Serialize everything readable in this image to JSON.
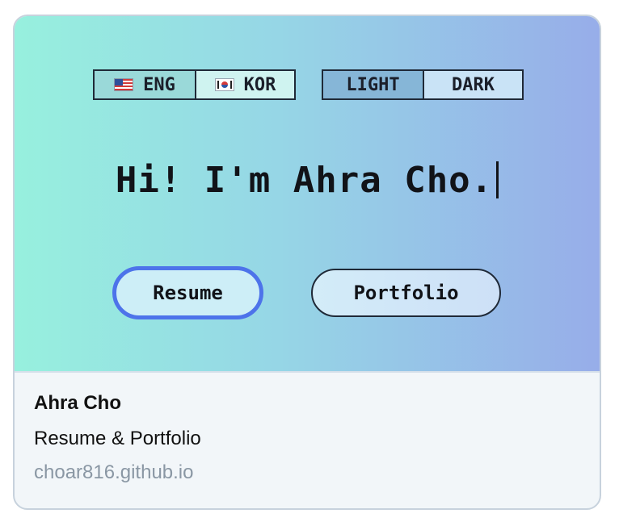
{
  "hero": {
    "language_toggle": {
      "options": [
        {
          "label": "ENG",
          "icon": "us-flag-icon"
        },
        {
          "label": "KOR",
          "icon": "korea-flag-icon"
        }
      ],
      "selected": "ENG"
    },
    "theme_toggle": {
      "options": [
        {
          "label": "LIGHT"
        },
        {
          "label": "DARK"
        }
      ],
      "selected": "LIGHT"
    },
    "headline": "Hi! I'm Ahra Cho.",
    "buttons": {
      "resume": "Resume",
      "portfolio": "Portfolio"
    }
  },
  "meta": {
    "title": "Ahra Cho",
    "description": "Resume & Portfolio",
    "url": "choar816.github.io"
  },
  "colors": {
    "gradient_start": "#97f0de",
    "gradient_end": "#97ade9",
    "focus_ring": "#4d73ea",
    "url_text": "#8a97a4"
  }
}
